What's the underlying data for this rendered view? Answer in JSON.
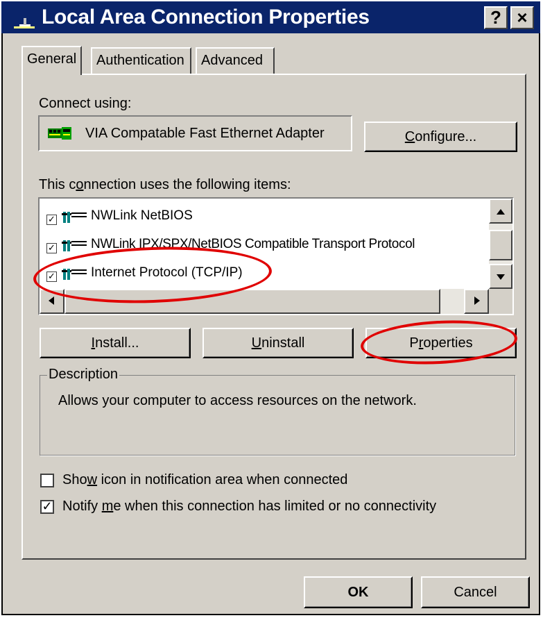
{
  "window": {
    "title": "Local Area Connection Properties",
    "help_label": "?",
    "close_label": "×"
  },
  "tabs": [
    {
      "label": "General",
      "active": true
    },
    {
      "label": "Authentication",
      "active": false
    },
    {
      "label": "Advanced",
      "active": false
    }
  ],
  "connect_using": {
    "label": "Connect using:",
    "adapter": "VIA Compatable Fast Ethernet Adapter",
    "configure_label_pre": "",
    "configure_label_u": "C",
    "configure_label_post": "onfigure..."
  },
  "items": {
    "label_pre": "This c",
    "label_u": "o",
    "label_post": "nnection uses the following items:",
    "list": [
      {
        "label": "NWLink NetBIOS",
        "checked": true
      },
      {
        "label": "NWLink IPX/SPX/NetBIOS Compatible Transport Protocol",
        "checked": true
      },
      {
        "label": "Internet Protocol (TCP/IP)",
        "checked": true
      }
    ]
  },
  "buttons": {
    "install_u": "I",
    "install_post": "nstall...",
    "uninstall_u": "U",
    "uninstall_post": "ninstall",
    "properties_pre": "P",
    "properties_u": "r",
    "properties_post": "operties",
    "ok": "OK",
    "cancel": "Cancel"
  },
  "description": {
    "legend": "Description",
    "text": "Allows your computer to access resources on the network."
  },
  "options": {
    "show_icon_pre": "Sho",
    "show_icon_u": "w",
    "show_icon_post": " icon in notification area when connected",
    "show_icon_checked": false,
    "notify_pre": "Notify ",
    "notify_u": "m",
    "notify_post": "e when this connection has limited or no connectivity",
    "notify_checked": true,
    "check_mark": "✓"
  },
  "annotation_color": "#e00000"
}
